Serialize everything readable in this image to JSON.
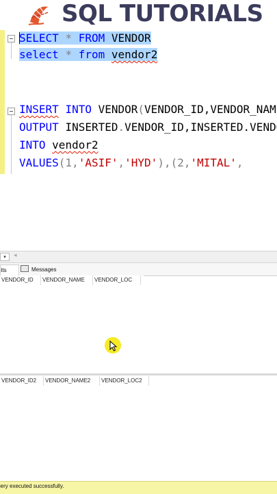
{
  "banner": {
    "title": "SQL TUTORIALS",
    "logo_icon": "sql-server-logo-icon"
  },
  "editor": {
    "line1": {
      "k1": "SELECT",
      "star": "*",
      "k2": "FROM",
      "t": "VENDOR"
    },
    "line2": {
      "k1": "select",
      "star": "*",
      "k2": "from",
      "t": "vendor2"
    },
    "line3": {
      "k1": "INSERT",
      "k2": "INTO",
      "t": "VENDOR",
      "p1": "(",
      "cols": "VENDOR_ID,VENDOR_NAME,VENDOR_LOC",
      "p2": ")"
    },
    "line4": {
      "k1": "OUTPUT",
      "t": "INSERTED",
      "dot": ".",
      "c": "VENDOR_ID",
      "rest": ",INSERTED.VENDOR_NAME,INSERTED.VENDOR_LOC"
    },
    "line5": {
      "k1": "INTO",
      "t": "vendor2"
    },
    "line6": {
      "k1": "VALUES",
      "a": "(1,",
      "s1": "'ASIF'",
      "b": ",",
      "s2": "'HYD'",
      "c": "),(2,",
      "s3": "'MITAL'",
      "d": ","
    }
  },
  "results": {
    "zoom": "▾",
    "tab_results": "Results",
    "tab_messages": "Messages",
    "grid1_columns": [
      "VENDOR_ID",
      "VENDOR_NAME",
      "VENDOR_LOC"
    ],
    "grid2_columns": [
      "VENDOR_ID2",
      "VENDOR_NAME2",
      "VENDOR_LOC2"
    ]
  },
  "status": {
    "text": "Query executed successfully."
  },
  "colors": {
    "keyword": "#0000ff",
    "string": "#c00000",
    "selection": "#add6ff",
    "status": "#f7f5a6"
  }
}
